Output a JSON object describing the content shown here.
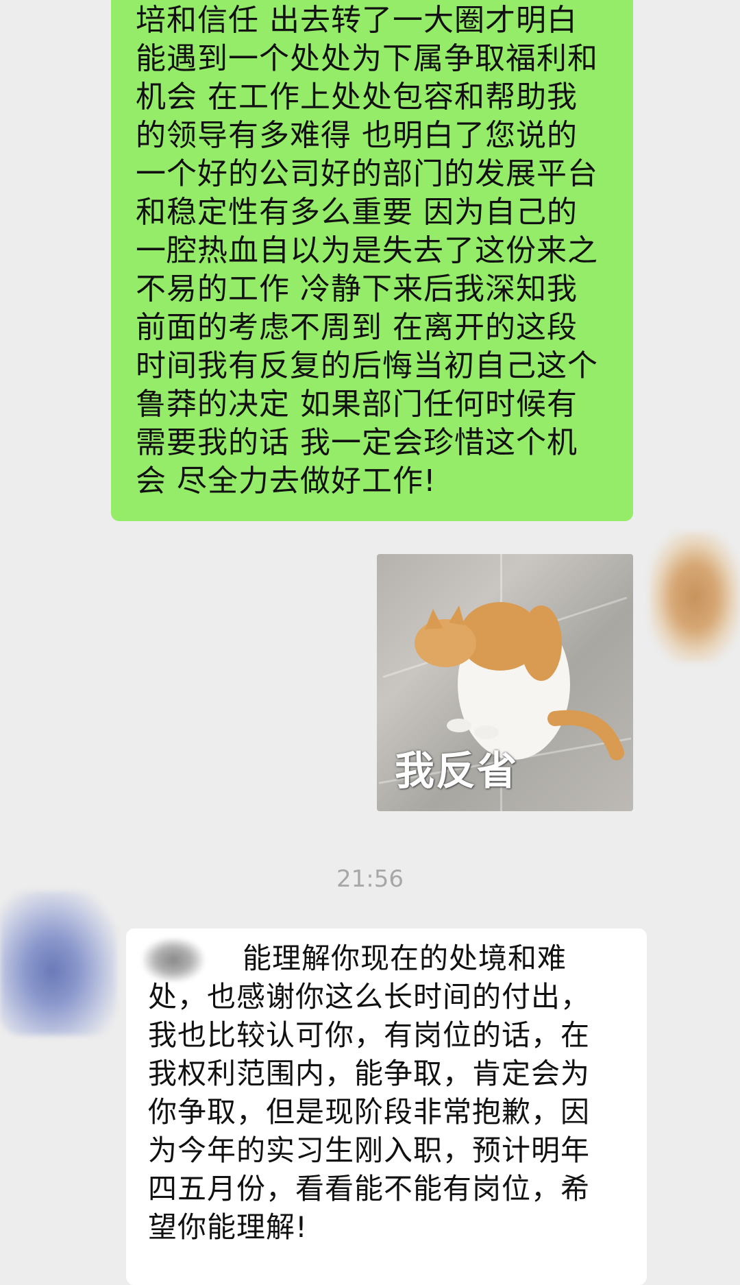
{
  "sent_message": {
    "lines": [
      "培和信任  出去转了一大圈才明白",
      "能遇到一个处处为下属争取福利和",
      "机会 在工作上处处包容和帮助我",
      "的领导有多难得 也明白了您说的",
      "一个好的公司好的部门的发展平台",
      "和稳定性有多么重要 因为自己的",
      "一腔热血自以为是失去了这份来之",
      "不易的工作 冷静下来后我深知我",
      "前面的考虑不周到 在离开的这段",
      "时间我有反复的后悔当初自己这个",
      "鲁莽的决定  如果部门任何时候有",
      "需要我的话  我一定会珍惜这个机",
      "会 尽全力去做好工作!"
    ]
  },
  "sticker": {
    "caption": "我反省",
    "icon": "cat-facing-wall-sticker"
  },
  "timestamp": "21:56",
  "received_message": {
    "lines": [
      "能理解你现在的处境和难",
      "处，也感谢你这么长时间的付出，",
      "我也比较认可你，有岗位的话，在",
      "我权利范围内，能争取，肯定会为",
      "你争取，但是现阶段非常抱歉，因",
      "为今年的实习生刚入职，预计明年",
      "四五月份，看看能不能有岗位，希",
      "望你能理解!"
    ]
  },
  "colors": {
    "background": "#ededed",
    "sent_bubble": "#95ec69",
    "received_bubble": "#ffffff",
    "timestamp": "#a7a7a7"
  }
}
